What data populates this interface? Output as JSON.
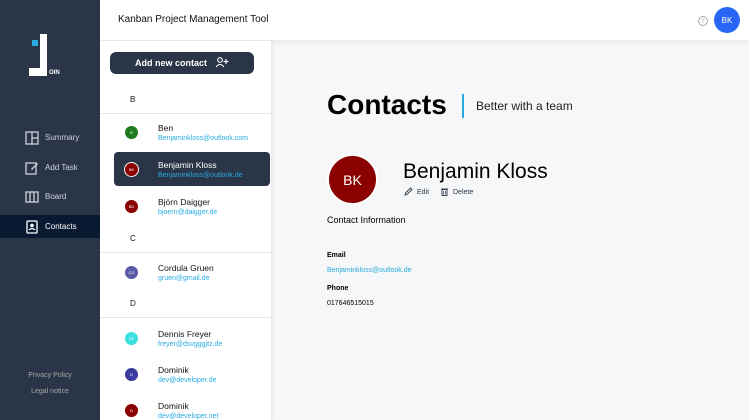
{
  "app": {
    "title": "Kanban Project Management Tool",
    "logo_text": "OIN",
    "user_initials": "BK",
    "help_icon": "help-circle-icon"
  },
  "colors": {
    "sidebar": "#2a3647",
    "active_nav": "#091931",
    "accent": "#29abe2",
    "avatar_header": "#2a66f5"
  },
  "nav": {
    "items": [
      {
        "label": "Summary",
        "icon": "summary-icon"
      },
      {
        "label": "Add Task",
        "icon": "edit-icon"
      },
      {
        "label": "Board",
        "icon": "board-icon"
      },
      {
        "label": "Contacts",
        "icon": "contacts-icon"
      }
    ],
    "active": "Contacts",
    "footer": {
      "privacy": "Privacy Policy",
      "legal": "Legal notice"
    }
  },
  "list": {
    "add_button": "Add new contact",
    "groups": [
      {
        "letter": "B",
        "contacts": [
          {
            "initials": "B",
            "name": "Ben",
            "email": "Benjaminkloss@outlook.com",
            "color": "#1f7a1f"
          },
          {
            "initials": "BK",
            "name": "Benjamin Kloss",
            "email": "Benjaminkloss@outlook.de",
            "color": "#8b0000",
            "selected": true
          },
          {
            "initials": "BD",
            "name": "Björn Daigger",
            "email": "bjoern@daigger.de",
            "color": "#8b0000"
          }
        ]
      },
      {
        "letter": "C",
        "contacts": [
          {
            "initials": "CG",
            "name": "Cordula Gruen",
            "email": "gruen@gmail.de",
            "color": "#5a5aa8"
          }
        ]
      },
      {
        "letter": "D",
        "contacts": [
          {
            "initials": "DF",
            "name": "Dennis Freyer",
            "email": "freyer@dsvgggjtz.de",
            "color": "#3be0e0"
          },
          {
            "initials": "D",
            "name": "Dominik",
            "email": "dev@developer.de",
            "color": "#3a3aa0"
          },
          {
            "initials": "D",
            "name": "Dominik",
            "email": "dev@developer.net",
            "color": "#8b0000"
          }
        ]
      }
    ]
  },
  "detail": {
    "title": "Contacts",
    "subtitle": "Better with a team",
    "initials": "BK",
    "avatar_color": "#8b0000",
    "name": "Benjamin Kloss",
    "edit_label": "Edit",
    "delete_label": "Delete",
    "info_heading": "Contact Information",
    "email_label": "Email",
    "email": "Benjaminkloss@outlook.de",
    "phone_label": "Phone",
    "phone": "017646515015"
  }
}
